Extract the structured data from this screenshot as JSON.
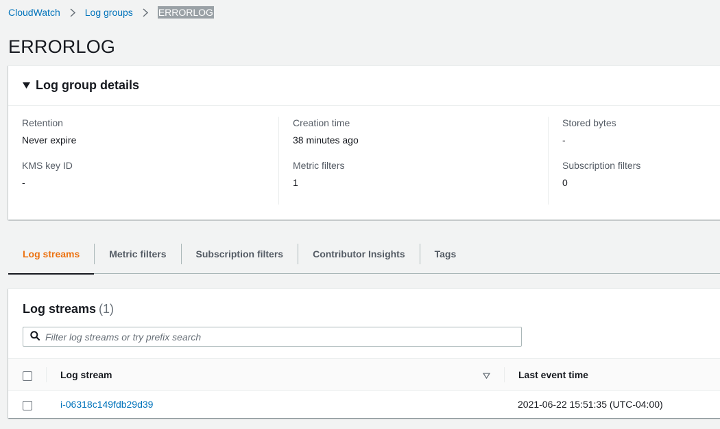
{
  "breadcrumb": {
    "items": [
      "CloudWatch",
      "Log groups"
    ],
    "current": "ERRORLOG"
  },
  "page": {
    "title": "ERRORLOG"
  },
  "details": {
    "title": "Log group details",
    "fields": {
      "retention": {
        "label": "Retention",
        "value": "Never expire"
      },
      "kms": {
        "label": "KMS key ID",
        "value": "-"
      },
      "creation": {
        "label": "Creation time",
        "value": "38 minutes ago"
      },
      "metric": {
        "label": "Metric filters",
        "value": "1"
      },
      "stored": {
        "label": "Stored bytes",
        "value": "-"
      },
      "subscription": {
        "label": "Subscription filters",
        "value": "0"
      }
    }
  },
  "tabs": [
    "Log streams",
    "Metric filters",
    "Subscription filters",
    "Contributor Insights",
    "Tags"
  ],
  "streams": {
    "heading": "Log streams",
    "count": "(1)",
    "search_placeholder": "Filter log streams or try prefix search",
    "columns": {
      "stream": "Log stream",
      "last_event": "Last event time"
    },
    "rows": [
      {
        "name": "i-06318c149fdb29d39",
        "last_event": "2021-06-22 15:51:35 (UTC-04:00)"
      }
    ]
  },
  "colors": {
    "link": "#0073bb",
    "active_tab": "#ec7211",
    "background": "#f2f3f3"
  }
}
